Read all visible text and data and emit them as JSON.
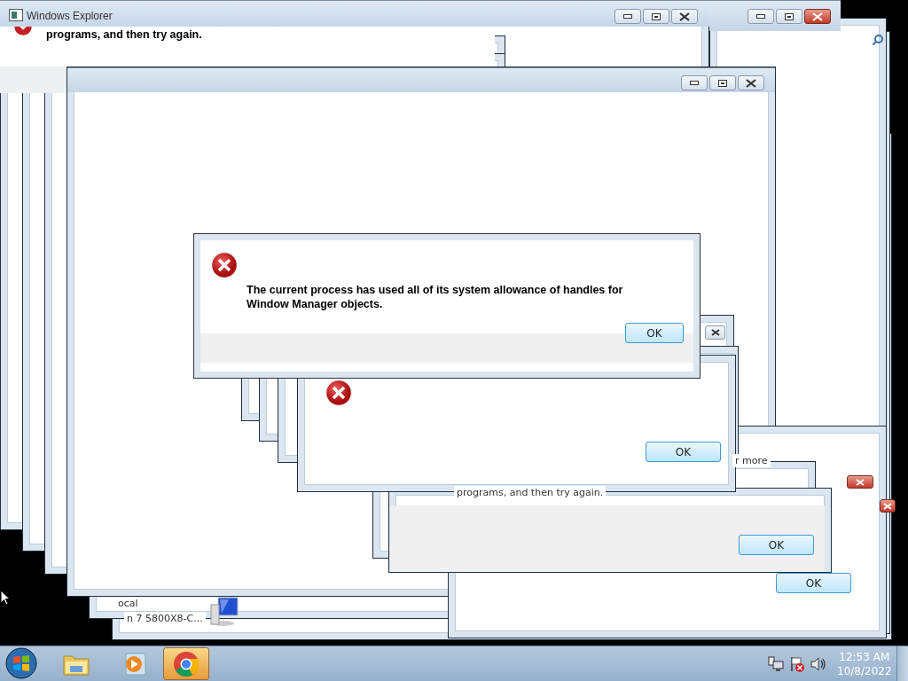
{
  "explorer": {
    "title": "Windows Explorer",
    "message": "programs, and then try again."
  },
  "caption_windows": [
    {
      "active": false
    },
    {
      "active": true
    },
    {
      "active": false
    }
  ],
  "main_dialog": {
    "message": "The current process has used all of its system allowance of handles for Window Manager objects.",
    "button": "OK"
  },
  "second_dialog": {
    "button": "OK"
  },
  "fragments": [
    {
      "text": "r more"
    },
    {
      "text": "programs, and then try again."
    },
    {
      "text": "ocal"
    },
    {
      "text": "n 7 5800X8-C..."
    }
  ],
  "buttons": [
    "OK",
    "OK"
  ],
  "taskbar": {
    "items": [
      {
        "kind": "start",
        "selected": false
      },
      {
        "kind": "explorer",
        "selected": false
      },
      {
        "kind": "media",
        "selected": false
      },
      {
        "kind": "chrome",
        "selected": true
      }
    ],
    "time": "12:53 AM",
    "date": "10/8/2022"
  }
}
